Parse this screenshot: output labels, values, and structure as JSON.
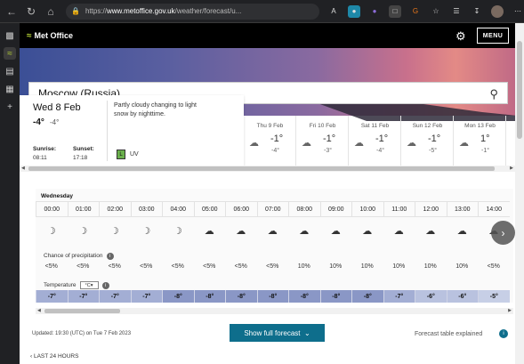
{
  "browser": {
    "url_prefix": "https://",
    "url_domain": "www.metoffice.gov.uk",
    "url_rest": "/weather/forecast/u..."
  },
  "header": {
    "logo_text": "Met Office",
    "menu_label": "MENU"
  },
  "search": {
    "value": "Moscow (Russia)"
  },
  "today": {
    "date": "Wed 8 Feb",
    "max_temp": "-4°",
    "min_temp": "-4°",
    "description": "Partly cloudy changing to light snow by nighttime.",
    "sunrise_label": "Sunrise:",
    "sunrise": "08:11",
    "sunset_label": "Sunset:",
    "sunset": "17:18",
    "uv_level": "L",
    "uv_label": "UV"
  },
  "days": [
    {
      "name": "Thu 9 Feb",
      "max": "-1°",
      "min": "-4°"
    },
    {
      "name": "Fri 10 Feb",
      "max": "-1°",
      "min": "-3°"
    },
    {
      "name": "Sat 11 Feb",
      "max": "-1°",
      "min": "-4°"
    },
    {
      "name": "Sun 12 Feb",
      "max": "-1°",
      "min": "-5°"
    },
    {
      "name": "Mon 13 Feb",
      "max": "1°",
      "min": "-1°"
    }
  ],
  "hourly": {
    "day_name": "Wednesday",
    "times": [
      "00:00",
      "01:00",
      "02:00",
      "03:00",
      "04:00",
      "05:00",
      "06:00",
      "07:00",
      "08:00",
      "09:00",
      "10:00",
      "11:00",
      "12:00",
      "13:00",
      "14:00"
    ],
    "icons": [
      "moon-icon",
      "moon-icon",
      "moon-icon",
      "moon-icon",
      "moon-icon",
      "cloud-moon-icon",
      "cloud-moon-icon",
      "cloud-moon-icon",
      "cloud-icon",
      "cloud-icon",
      "cloud-icon",
      "cloud-icon",
      "cloud-icon",
      "cloud-icon",
      "cloud-icon"
    ],
    "precip_label": "Chance of precipitation",
    "precip": [
      "<5%",
      "<5%",
      "<5%",
      "<5%",
      "<5%",
      "<5%",
      "<5%",
      "<5%",
      "10%",
      "10%",
      "10%",
      "10%",
      "10%",
      "10%",
      "<5%"
    ],
    "temp_label": "Temperature",
    "unit": "°C",
    "temps": [
      "-7°",
      "-7°",
      "-7°",
      "-7°",
      "-8°",
      "-8°",
      "-8°",
      "-8°",
      "-8°",
      "-8°",
      "-8°",
      "-7°",
      "-6°",
      "-6°",
      "-5°"
    ]
  },
  "footer": {
    "updated": "Updated: 19:30 (UTC) on Tue 7 Feb 2023",
    "show_full": "Show full forecast",
    "explained": "Forecast table explained",
    "last24": "LAST 24 HOURS"
  },
  "colors": {
    "brand_green": "#b5d335",
    "button_teal": "#0e6e8c",
    "temp_cold": "#8e9bc8"
  }
}
